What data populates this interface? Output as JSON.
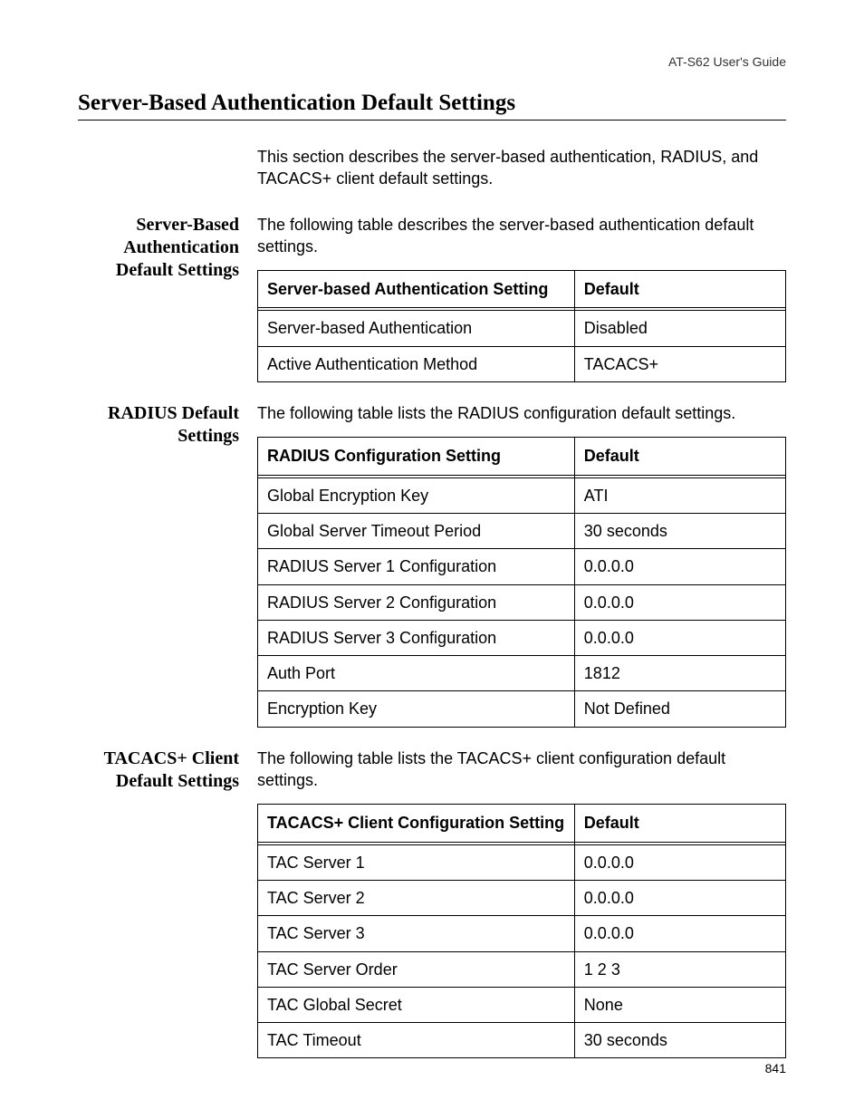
{
  "running_head": "AT-S62 User's Guide",
  "page_number": "841",
  "title": "Server-Based Authentication Default Settings",
  "intro": "This section describes the server-based authentication, RADIUS, and TACACS+ client default settings.",
  "sections": [
    {
      "label_lines": [
        "Server-Based",
        "Authentication",
        "Default Settings"
      ],
      "lead": "The following table describes the server-based authentication default settings.",
      "table": {
        "head": [
          "Server-based Authentication Setting",
          "Default"
        ],
        "rows": [
          [
            "Server-based Authentication",
            "Disabled"
          ],
          [
            "Active Authentication Method",
            "TACACS+"
          ]
        ]
      }
    },
    {
      "label_lines": [
        "RADIUS Default",
        "Settings"
      ],
      "lead": "The following table lists the RADIUS configuration default settings.",
      "table": {
        "head": [
          "RADIUS Configuration Setting",
          "Default"
        ],
        "rows": [
          [
            "Global Encryption Key",
            "ATI"
          ],
          [
            "Global Server Timeout Period",
            "30 seconds"
          ],
          [
            "RADIUS Server 1 Configuration",
            "0.0.0.0"
          ],
          [
            "RADIUS Server 2 Configuration",
            "0.0.0.0"
          ],
          [
            "RADIUS Server 3 Configuration",
            "0.0.0.0"
          ],
          [
            "Auth Port",
            "1812"
          ],
          [
            "Encryption Key",
            "Not Defined"
          ]
        ]
      }
    },
    {
      "label_lines": [
        "TACACS+ Client",
        "Default Settings"
      ],
      "lead": "The following table lists the TACACS+ client configuration default settings.",
      "table": {
        "head": [
          "TACACS+ Client Configuration Setting",
          "Default"
        ],
        "rows": [
          [
            "TAC Server 1",
            "0.0.0.0"
          ],
          [
            "TAC Server 2",
            "0.0.0.0"
          ],
          [
            "TAC Server 3",
            "0.0.0.0"
          ],
          [
            "TAC Server Order",
            "1 2 3"
          ],
          [
            "TAC Global Secret",
            "None"
          ],
          [
            "TAC Timeout",
            "30 seconds"
          ]
        ]
      }
    }
  ]
}
